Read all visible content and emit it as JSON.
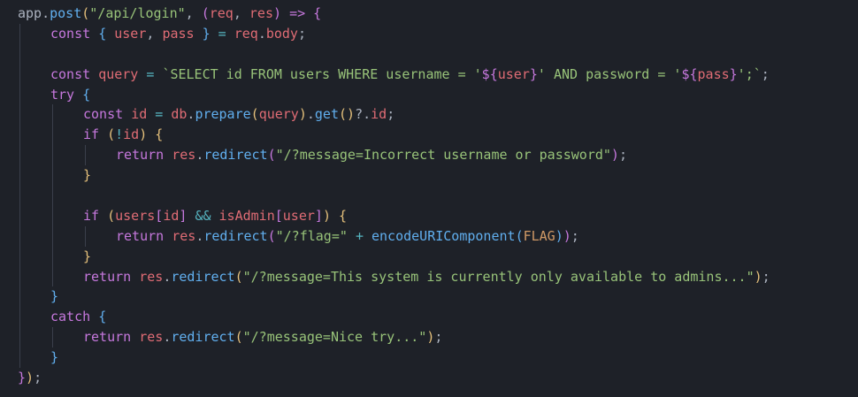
{
  "colors": {
    "background": "#1e2128",
    "keyword": "#c678dd",
    "variable": "#e06c75",
    "function": "#61afef",
    "string": "#98c379",
    "operator": "#56b6c2",
    "plain": "#abb2bf",
    "bracket_level_1": "#e5c07b",
    "bracket_level_2": "#c678dd",
    "bracket_level_3": "#61afef",
    "constant": "#d19a66"
  },
  "code": {
    "lines": [
      {
        "indent": 0,
        "guides": [],
        "tokens": [
          {
            "t": "app",
            "c": "plain"
          },
          {
            "t": ".",
            "c": "plain"
          },
          {
            "t": "post",
            "c": "fn"
          },
          {
            "t": "(",
            "c": "br1"
          },
          {
            "t": "\"/api/login\"",
            "c": "str"
          },
          {
            "t": ", ",
            "c": "plain"
          },
          {
            "t": "(",
            "c": "br2"
          },
          {
            "t": "req",
            "c": "var"
          },
          {
            "t": ", ",
            "c": "plain"
          },
          {
            "t": "res",
            "c": "var"
          },
          {
            "t": ")",
            "c": "br2"
          },
          {
            "t": " ",
            "c": "plain"
          },
          {
            "t": "=>",
            "c": "kw"
          },
          {
            "t": " ",
            "c": "plain"
          },
          {
            "t": "{",
            "c": "br2"
          }
        ]
      },
      {
        "indent": 1,
        "guides": [
          0
        ],
        "tokens": [
          {
            "t": "const",
            "c": "kw"
          },
          {
            "t": " ",
            "c": "plain"
          },
          {
            "t": "{",
            "c": "br3"
          },
          {
            "t": " ",
            "c": "plain"
          },
          {
            "t": "user",
            "c": "var"
          },
          {
            "t": ", ",
            "c": "plain"
          },
          {
            "t": "pass",
            "c": "var"
          },
          {
            "t": " ",
            "c": "plain"
          },
          {
            "t": "}",
            "c": "br3"
          },
          {
            "t": " ",
            "c": "plain"
          },
          {
            "t": "=",
            "c": "op"
          },
          {
            "t": " ",
            "c": "plain"
          },
          {
            "t": "req",
            "c": "var"
          },
          {
            "t": ".",
            "c": "plain"
          },
          {
            "t": "body",
            "c": "var"
          },
          {
            "t": ";",
            "c": "plain"
          }
        ]
      },
      {
        "indent": 1,
        "guides": [
          0
        ],
        "tokens": []
      },
      {
        "indent": 1,
        "guides": [
          0
        ],
        "tokens": [
          {
            "t": "const",
            "c": "kw"
          },
          {
            "t": " ",
            "c": "plain"
          },
          {
            "t": "query",
            "c": "var"
          },
          {
            "t": " ",
            "c": "plain"
          },
          {
            "t": "=",
            "c": "op"
          },
          {
            "t": " ",
            "c": "plain"
          },
          {
            "t": "`SELECT id FROM users WHERE username = '",
            "c": "str"
          },
          {
            "t": "${",
            "c": "kw"
          },
          {
            "t": "user",
            "c": "var"
          },
          {
            "t": "}",
            "c": "kw"
          },
          {
            "t": "' AND password = '",
            "c": "str"
          },
          {
            "t": "${",
            "c": "kw"
          },
          {
            "t": "pass",
            "c": "var"
          },
          {
            "t": "}",
            "c": "kw"
          },
          {
            "t": "';`",
            "c": "str"
          },
          {
            "t": ";",
            "c": "plain"
          }
        ]
      },
      {
        "indent": 1,
        "guides": [
          0
        ],
        "tokens": [
          {
            "t": "try",
            "c": "kw"
          },
          {
            "t": " ",
            "c": "plain"
          },
          {
            "t": "{",
            "c": "br3"
          }
        ]
      },
      {
        "indent": 2,
        "guides": [
          0,
          1
        ],
        "tokens": [
          {
            "t": "const",
            "c": "kw"
          },
          {
            "t": " ",
            "c": "plain"
          },
          {
            "t": "id",
            "c": "var"
          },
          {
            "t": " ",
            "c": "plain"
          },
          {
            "t": "=",
            "c": "op"
          },
          {
            "t": " ",
            "c": "plain"
          },
          {
            "t": "db",
            "c": "var"
          },
          {
            "t": ".",
            "c": "plain"
          },
          {
            "t": "prepare",
            "c": "fn"
          },
          {
            "t": "(",
            "c": "br1"
          },
          {
            "t": "query",
            "c": "var"
          },
          {
            "t": ")",
            "c": "br1"
          },
          {
            "t": ".",
            "c": "plain"
          },
          {
            "t": "get",
            "c": "fn"
          },
          {
            "t": "(",
            "c": "br1"
          },
          {
            "t": ")",
            "c": "br1"
          },
          {
            "t": "?.",
            "c": "plain"
          },
          {
            "t": "id",
            "c": "var"
          },
          {
            "t": ";",
            "c": "plain"
          }
        ]
      },
      {
        "indent": 2,
        "guides": [
          0,
          1
        ],
        "tokens": [
          {
            "t": "if",
            "c": "kw"
          },
          {
            "t": " ",
            "c": "plain"
          },
          {
            "t": "(",
            "c": "br1"
          },
          {
            "t": "!",
            "c": "op"
          },
          {
            "t": "id",
            "c": "var"
          },
          {
            "t": ")",
            "c": "br1"
          },
          {
            "t": " ",
            "c": "plain"
          },
          {
            "t": "{",
            "c": "br1"
          }
        ]
      },
      {
        "indent": 3,
        "guides": [
          0,
          1,
          2
        ],
        "tokens": [
          {
            "t": "return",
            "c": "kw"
          },
          {
            "t": " ",
            "c": "plain"
          },
          {
            "t": "res",
            "c": "var"
          },
          {
            "t": ".",
            "c": "plain"
          },
          {
            "t": "redirect",
            "c": "fn"
          },
          {
            "t": "(",
            "c": "br2"
          },
          {
            "t": "\"/?message=Incorrect username or password\"",
            "c": "str"
          },
          {
            "t": ")",
            "c": "br2"
          },
          {
            "t": ";",
            "c": "plain"
          }
        ]
      },
      {
        "indent": 2,
        "guides": [
          0,
          1
        ],
        "tokens": [
          {
            "t": "}",
            "c": "br1"
          }
        ]
      },
      {
        "indent": 2,
        "guides": [
          0,
          1
        ],
        "tokens": []
      },
      {
        "indent": 2,
        "guides": [
          0,
          1
        ],
        "tokens": [
          {
            "t": "if",
            "c": "kw"
          },
          {
            "t": " ",
            "c": "plain"
          },
          {
            "t": "(",
            "c": "br1"
          },
          {
            "t": "users",
            "c": "var"
          },
          {
            "t": "[",
            "c": "br2"
          },
          {
            "t": "id",
            "c": "var"
          },
          {
            "t": "]",
            "c": "br2"
          },
          {
            "t": " ",
            "c": "plain"
          },
          {
            "t": "&&",
            "c": "op"
          },
          {
            "t": " ",
            "c": "plain"
          },
          {
            "t": "isAdmin",
            "c": "var"
          },
          {
            "t": "[",
            "c": "br2"
          },
          {
            "t": "user",
            "c": "var"
          },
          {
            "t": "]",
            "c": "br2"
          },
          {
            "t": ")",
            "c": "br1"
          },
          {
            "t": " ",
            "c": "plain"
          },
          {
            "t": "{",
            "c": "br1"
          }
        ]
      },
      {
        "indent": 3,
        "guides": [
          0,
          1,
          2
        ],
        "tokens": [
          {
            "t": "return",
            "c": "kw"
          },
          {
            "t": " ",
            "c": "plain"
          },
          {
            "t": "res",
            "c": "var"
          },
          {
            "t": ".",
            "c": "plain"
          },
          {
            "t": "redirect",
            "c": "fn"
          },
          {
            "t": "(",
            "c": "br2"
          },
          {
            "t": "\"/?flag=\"",
            "c": "str"
          },
          {
            "t": " ",
            "c": "plain"
          },
          {
            "t": "+",
            "c": "op"
          },
          {
            "t": " ",
            "c": "plain"
          },
          {
            "t": "encodeURIComponent",
            "c": "fn"
          },
          {
            "t": "(",
            "c": "br3"
          },
          {
            "t": "FLAG",
            "c": "const"
          },
          {
            "t": ")",
            "c": "br3"
          },
          {
            "t": ")",
            "c": "br2"
          },
          {
            "t": ";",
            "c": "plain"
          }
        ]
      },
      {
        "indent": 2,
        "guides": [
          0,
          1
        ],
        "tokens": [
          {
            "t": "}",
            "c": "br1"
          }
        ]
      },
      {
        "indent": 2,
        "guides": [
          0,
          1
        ],
        "tokens": [
          {
            "t": "return",
            "c": "kw"
          },
          {
            "t": " ",
            "c": "plain"
          },
          {
            "t": "res",
            "c": "var"
          },
          {
            "t": ".",
            "c": "plain"
          },
          {
            "t": "redirect",
            "c": "fn"
          },
          {
            "t": "(",
            "c": "br1"
          },
          {
            "t": "\"/?message=This system is currently only available to admins...\"",
            "c": "str"
          },
          {
            "t": ")",
            "c": "br1"
          },
          {
            "t": ";",
            "c": "plain"
          }
        ]
      },
      {
        "indent": 1,
        "guides": [
          0
        ],
        "tokens": [
          {
            "t": "}",
            "c": "br3"
          }
        ]
      },
      {
        "indent": 1,
        "guides": [
          0
        ],
        "tokens": [
          {
            "t": "catch",
            "c": "kw"
          },
          {
            "t": " ",
            "c": "plain"
          },
          {
            "t": "{",
            "c": "br3"
          }
        ]
      },
      {
        "indent": 2,
        "guides": [
          0,
          1
        ],
        "tokens": [
          {
            "t": "return",
            "c": "kw"
          },
          {
            "t": " ",
            "c": "plain"
          },
          {
            "t": "res",
            "c": "var"
          },
          {
            "t": ".",
            "c": "plain"
          },
          {
            "t": "redirect",
            "c": "fn"
          },
          {
            "t": "(",
            "c": "br1"
          },
          {
            "t": "\"/?message=Nice try...\"",
            "c": "str"
          },
          {
            "t": ")",
            "c": "br1"
          },
          {
            "t": ";",
            "c": "plain"
          }
        ]
      },
      {
        "indent": 1,
        "guides": [
          0
        ],
        "tokens": [
          {
            "t": "}",
            "c": "br3"
          }
        ]
      },
      {
        "indent": 0,
        "guides": [],
        "tokens": [
          {
            "t": "}",
            "c": "br2"
          },
          {
            "t": ")",
            "c": "br1"
          },
          {
            "t": ";",
            "c": "plain"
          }
        ]
      }
    ]
  }
}
